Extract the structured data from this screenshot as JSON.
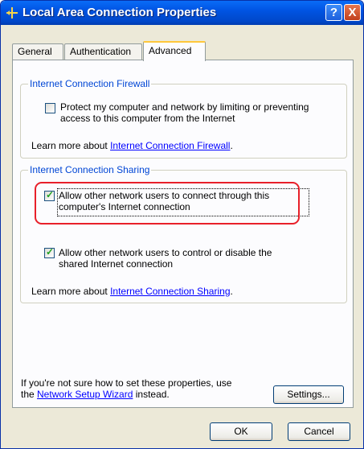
{
  "window": {
    "title": "Local Area Connection Properties",
    "help_label": "?",
    "close_label": "X"
  },
  "tabs": [
    {
      "label": "General",
      "active": false
    },
    {
      "label": "Authentication",
      "active": false
    },
    {
      "label": "Advanced",
      "active": true
    }
  ],
  "firewall_group": {
    "label": "Internet Connection Firewall",
    "checkbox_text_line1": "Protect my computer and network by limiting or preventing",
    "checkbox_text_line2": "access to this computer from the Internet",
    "checked": false,
    "learn_prefix": "Learn more about ",
    "learn_link": "Internet Connection Firewall",
    "learn_suffix": "."
  },
  "sharing_group": {
    "label": "Internet Connection Sharing",
    "allow_connect_line1": "Allow other network users to connect through this",
    "allow_connect_line2": "computer's Internet connection",
    "allow_connect_checked": true,
    "allow_control_line1": "Allow other network users to control or disable the",
    "allow_control_line2": "shared Internet connection",
    "allow_control_checked": true,
    "learn_prefix": "Learn more about ",
    "learn_link": "Internet Connection Sharing",
    "learn_suffix": "."
  },
  "footer": {
    "help_line1": "If you're not sure how to set these properties, use",
    "help_prefix": "the ",
    "wizard_link": "Network Setup Wizard",
    "help_suffix": " instead.",
    "settings_label": "Settings...",
    "ok_label": "OK",
    "cancel_label": "Cancel"
  },
  "colors": {
    "titlebar": "#0054e3",
    "group_label": "#0046d5",
    "link": "#0000ff",
    "annotation_highlight": "#e8202a",
    "tab_active_accent": "#ffc83c"
  }
}
